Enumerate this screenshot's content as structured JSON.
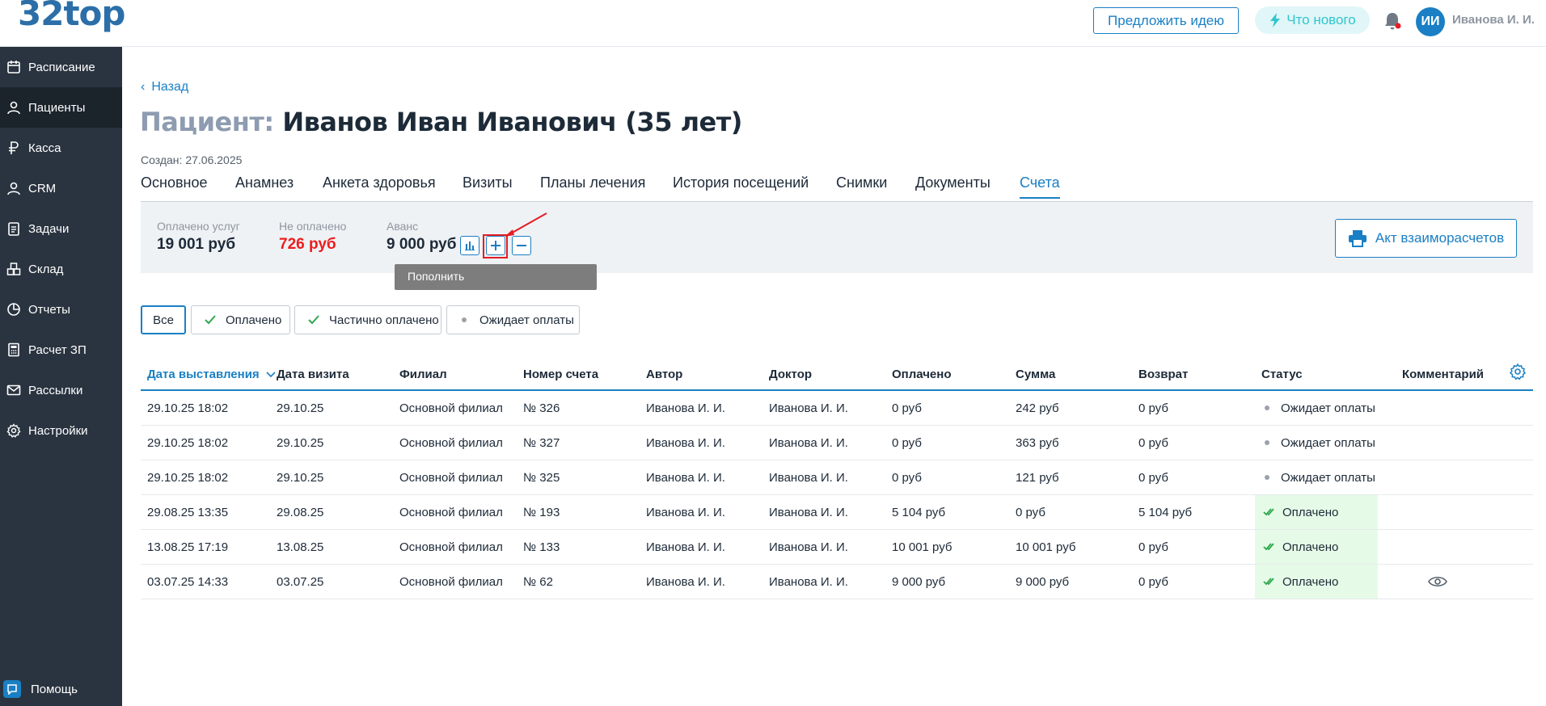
{
  "header": {
    "logo": "32top",
    "suggest_idea": "Предложить идею",
    "whats_new": "Что нового",
    "avatar_initials": "ИИ",
    "user_name": "Иванова И. И."
  },
  "sidebar": {
    "items": [
      {
        "label": "Расписание",
        "icon": "calendar-icon"
      },
      {
        "label": "Пациенты",
        "icon": "user-icon",
        "active": true
      },
      {
        "label": "Касса",
        "icon": "ruble-icon"
      },
      {
        "label": "CRM",
        "icon": "user-icon"
      },
      {
        "label": "Задачи",
        "icon": "tasks-icon"
      },
      {
        "label": "Склад",
        "icon": "boxes-icon"
      },
      {
        "label": "Отчеты",
        "icon": "pie-chart-icon"
      },
      {
        "label": "Расчет ЗП",
        "icon": "calculator-icon"
      },
      {
        "label": "Рассылки",
        "icon": "mail-icon"
      },
      {
        "label": "Настройки",
        "icon": "gear-icon"
      }
    ],
    "help": "Помощь"
  },
  "page": {
    "back": "Назад",
    "title_prefix": "Пациент:",
    "title_name": "Иванов Иван Иванович (35 лет)",
    "created": "Создан: 27.06.2025"
  },
  "tabs": [
    "Основное",
    "Анамнез",
    "Анкета здоровья",
    "Визиты",
    "Планы лечения",
    "История посещений",
    "Снимки",
    "Документы",
    "Счета"
  ],
  "active_tab": "Счета",
  "summary": {
    "paid_label": "Оплачено услуг",
    "paid_value": "19 001 руб",
    "unpaid_label": "Не оплачено",
    "unpaid_value": "726 руб",
    "advance_label": "Аванс",
    "advance_value": "9 000 руб",
    "tooltip": "Пополнить",
    "act_button": "Акт взаиморасчетов"
  },
  "filters": [
    "Все",
    "Оплачено",
    "Частично оплачено",
    "Ожидает оплаты"
  ],
  "table": {
    "columns": [
      "Дата выставления",
      "Дата визита",
      "Филиал",
      "Номер счета",
      "Автор",
      "Доктор",
      "Оплачено",
      "Сумма",
      "Возврат",
      "Статус",
      "Комментарий"
    ],
    "rows": [
      [
        "29.10.25 18:02",
        "29.10.25",
        "Основной филиал",
        "№ 326",
        "Иванова И. И.",
        "Иванова И. И.",
        "0 руб",
        "242 руб",
        "0 руб",
        "Ожидает оплаты",
        ""
      ],
      [
        "29.10.25 18:02",
        "29.10.25",
        "Основной филиал",
        "№ 327",
        "Иванова И. И.",
        "Иванова И. И.",
        "0 руб",
        "363 руб",
        "0 руб",
        "Ожидает оплаты",
        ""
      ],
      [
        "29.10.25 18:02",
        "29.10.25",
        "Основной филиал",
        "№ 325",
        "Иванова И. И.",
        "Иванова И. И.",
        "0 руб",
        "121 руб",
        "0 руб",
        "Ожидает оплаты",
        ""
      ],
      [
        "29.08.25 13:35",
        "29.08.25",
        "Основной филиал",
        "№ 193",
        "Иванова И. И.",
        "Иванова И. И.",
        "5 104 руб",
        "0 руб",
        "5 104 руб",
        "Оплачено",
        ""
      ],
      [
        "13.08.25 17:19",
        "13.08.25",
        "Основной филиал",
        "№ 133",
        "Иванова И. И.",
        "Иванова И. И.",
        "10 001 руб",
        "10 001 руб",
        "0 руб",
        "Оплачено",
        ""
      ],
      [
        "03.07.25 14:33",
        "03.07.25",
        "Основной филиал",
        "№ 62",
        "Иванова И. И.",
        "Иванова И. И.",
        "9 000 руб",
        "9 000 руб",
        "0 руб",
        "Оплачено",
        "eye-icon"
      ]
    ]
  },
  "colors": {
    "accent": "#1a7fc4",
    "sidebar": "#2a3440",
    "unpaid": "#ee1c1c",
    "paid_bg": "#e6fbe7",
    "annotation": "#e31e24"
  }
}
